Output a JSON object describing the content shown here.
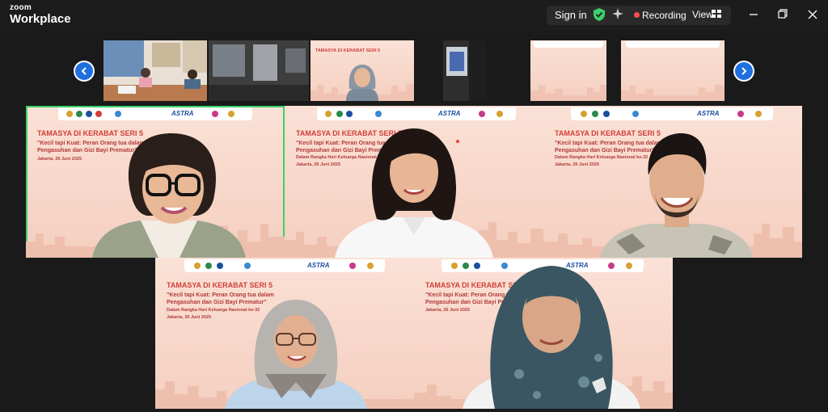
{
  "app": {
    "logo_top": "zoom",
    "logo_bottom": "Workplace"
  },
  "header": {
    "sign_in": "Sign in",
    "recording": "Recording",
    "view": "View"
  },
  "event": {
    "title": "TAMASYA DI KERABAT SERI 5",
    "subtitle_line1": "\"Kecil tapi Kuat: Peran Orang tua dalam",
    "subtitle_line2": "Pengasuhan dan Gizi Bayi Prematur\"",
    "context": "Dalam Rangka Hari Keluarga Nasional ke-32",
    "date": "Jakarta, 26 Juni 2025",
    "sponsor": "ASTRA"
  },
  "colors": {
    "active_speaker": "#3bd06a",
    "recording": "#ff4d4d",
    "nav_arrow": "#1f6fe0",
    "background_tint": "#f8d8cb"
  }
}
